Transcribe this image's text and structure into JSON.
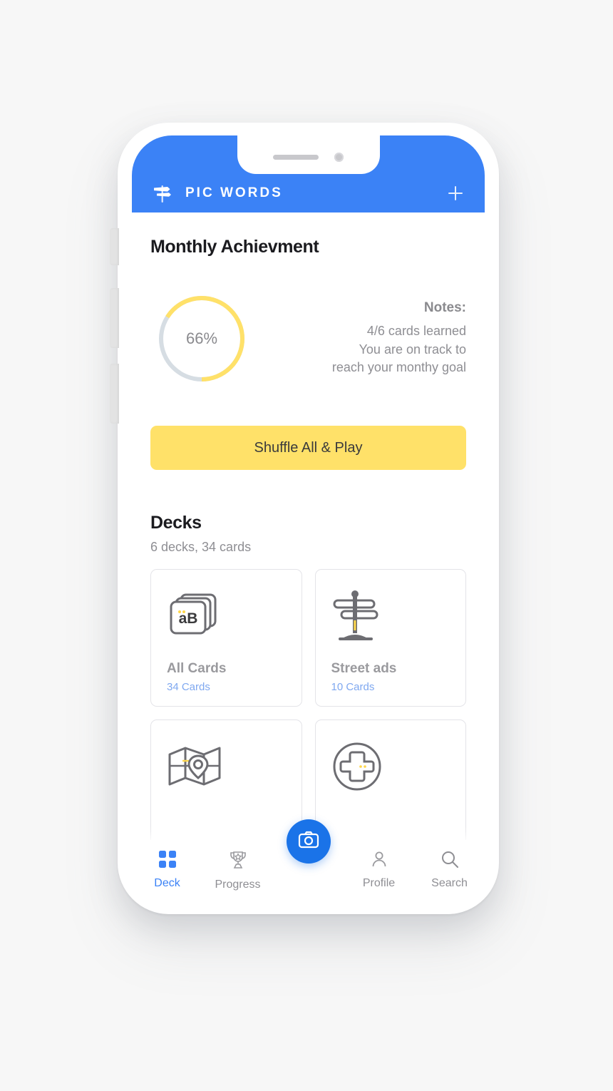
{
  "app": {
    "brand": "PIC WORDS",
    "logo_icon": "signpost-icon",
    "add_icon": "plus-icon",
    "header_color": "#3b82f6"
  },
  "achievement": {
    "title": "Monthly Achievment",
    "percent_label": "66%",
    "percent_value": 66,
    "ring_color": "#ffe169",
    "track_color": "#d6dde3",
    "notes_heading": "Notes:",
    "notes_lines": [
      "4/6 cards learned",
      "You are on track to",
      "reach your monthy goal"
    ]
  },
  "shuffle": {
    "label": "Shuffle All & Play",
    "color": "#ffe169"
  },
  "decks": {
    "title": "Decks",
    "subtitle": "6 decks, 34 cards",
    "items": [
      {
        "name": "All Cards",
        "count": "34 Cards",
        "icon": "card-stack-icon"
      },
      {
        "name": "Street ads",
        "count": "10 Cards",
        "icon": "signpost-icon"
      },
      {
        "name": "",
        "count": "",
        "icon": "folded-map-pin-icon"
      },
      {
        "name": "",
        "count": "",
        "icon": "circle-plus-icon"
      }
    ]
  },
  "tabbar": {
    "items": [
      {
        "label": "Deck",
        "icon": "grid-icon",
        "active": true
      },
      {
        "label": "Progress",
        "icon": "trophy-icon",
        "active": false
      },
      {
        "label": "",
        "icon": "camera-icon",
        "active": false
      },
      {
        "label": "Profile",
        "icon": "person-icon",
        "active": false
      },
      {
        "label": "Search",
        "icon": "search-icon",
        "active": false
      }
    ],
    "fab_icon": "camera-icon",
    "fab_color": "#1a73e8",
    "active_color": "#3b82f6"
  }
}
